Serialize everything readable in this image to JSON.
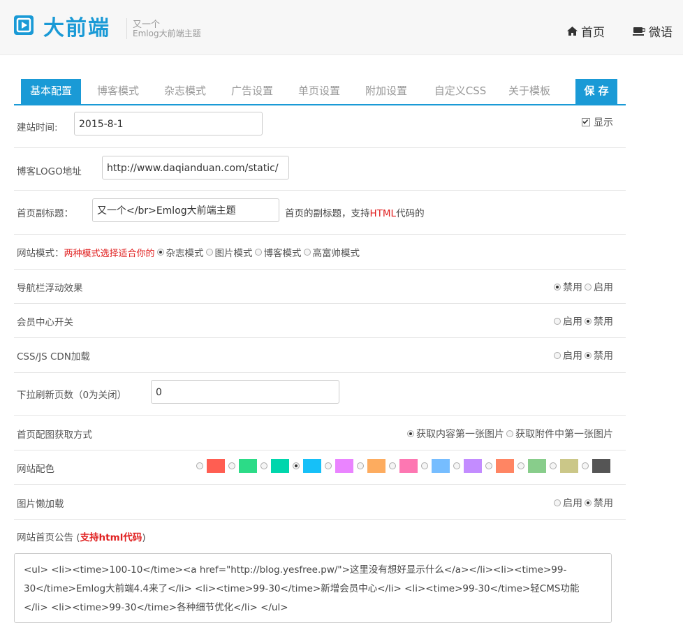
{
  "header": {
    "logo_text": "大前端",
    "tagline_line1": "又一个",
    "tagline_line2": "Emlog大前端主题",
    "nav": [
      {
        "label": "首页",
        "icon": "home-icon"
      },
      {
        "label": "微语",
        "icon": "cup-icon"
      }
    ]
  },
  "tabs": [
    {
      "label": "基本配置",
      "active": true
    },
    {
      "label": "博客模式"
    },
    {
      "label": "杂志模式"
    },
    {
      "label": "广告设置"
    },
    {
      "label": "单页设置"
    },
    {
      "label": "附加设置"
    },
    {
      "label": "自定义CSS"
    },
    {
      "label": "关于模板"
    },
    {
      "label": "保 存"
    }
  ],
  "site_time": {
    "label": "建站时间:",
    "value": "2015-8-1",
    "checkbox_label": "显示",
    "checked": true
  },
  "logo_url": {
    "label": "博客LOGO地址",
    "value": "http://www.daqianduan.com/static/"
  },
  "subtitle": {
    "label": "首页副标题：",
    "value": "又一个</br>Emlog大前端主题",
    "hint_prefix": "首页的副标题，支持",
    "hint_html": "HTML",
    "hint_suffix": "代码的"
  },
  "site_mode": {
    "label": "网站模式：",
    "hint": "两种模式选择适合你的",
    "options": [
      "杂志模式",
      "图片模式",
      "博客模式",
      "高富帅模式"
    ],
    "selected": 0
  },
  "nav_float": {
    "label": "导航栏浮动效果",
    "options": [
      "禁用",
      "启用"
    ],
    "selected": 0
  },
  "member_center": {
    "label": "会员中心开关",
    "options": [
      "启用",
      "禁用"
    ],
    "selected": 1
  },
  "cdn": {
    "label": "CSS/JS CDN加载",
    "options": [
      "启用",
      "禁用"
    ],
    "selected": 1
  },
  "refresh_pages": {
    "label": "下拉刷新页数（0为关闭）",
    "value": "0"
  },
  "cover_method": {
    "label": "首页配图获取方式",
    "options": [
      "获取内容第一张图片",
      "获取附件中第一张图片"
    ],
    "selected": 0
  },
  "color_scheme": {
    "label": "网站配色",
    "colors": [
      "#ff5e52",
      "#2cdb87",
      "#00d6ac",
      "#16c0f8",
      "#ea84ff",
      "#fdac5f",
      "#fd77b2",
      "#76bdff",
      "#c38cff",
      "#ff8563",
      "#88cd8b",
      "#cbc788",
      "#555555"
    ],
    "selected": 3
  },
  "lazy_load": {
    "label": "图片懒加载",
    "options": [
      "启用",
      "禁用"
    ],
    "selected": 1
  },
  "notice": {
    "label_prefix": "网站首页公告 (",
    "label_bold": "支持html代码",
    "label_suffix": ")",
    "content": "<ul> <li><time>100-10</time><a href=\"http://blog.yesfree.pw/\">这里没有想好显示什么</a></li><li><time>99-30</time>Emlog大前端4.4来了</li> <li><time>99-30</time>新增会员中心</li> <li><time>99-30</time>轻CMS功能</li> <li><time>99-30</time>各种细节优化</li> </ul>"
  }
}
